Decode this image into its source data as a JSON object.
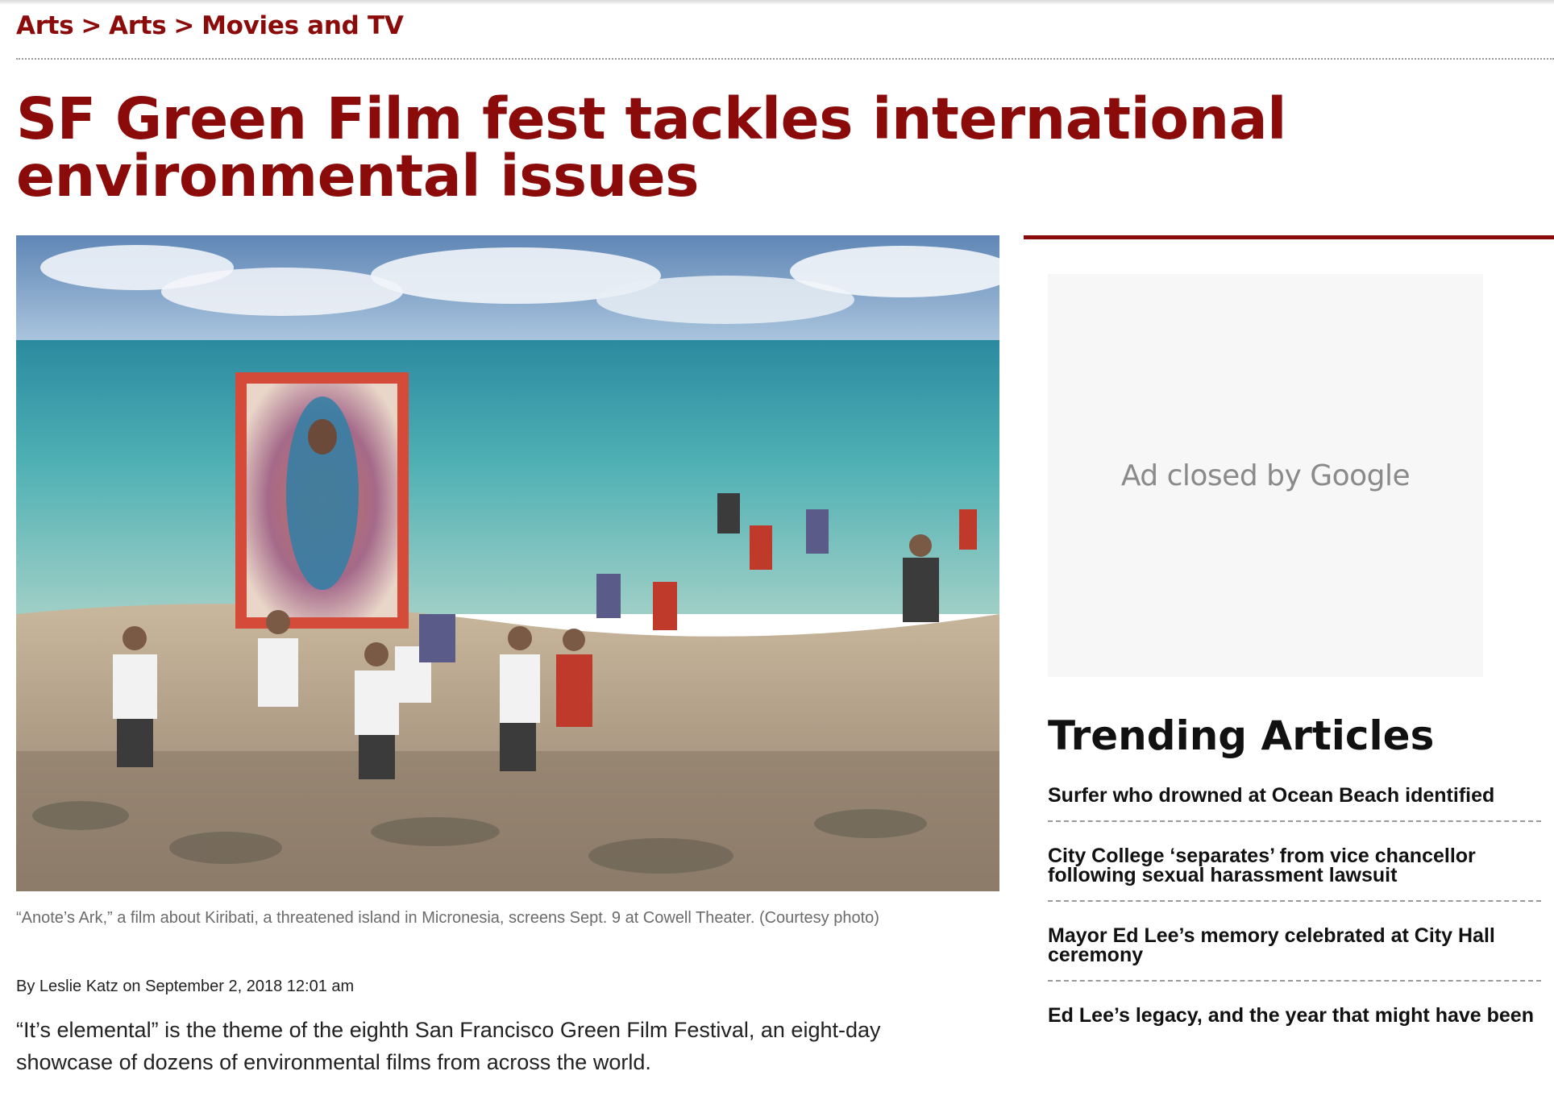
{
  "breadcrumb": {
    "items": [
      "Arts",
      "Arts",
      "Movies and TV"
    ],
    "separator": ">"
  },
  "article": {
    "title": "SF Green Film fest tackles international environmental issues",
    "image_caption": "“Anote’s Ark,” a film about Kiribati, a threatened island in Micronesia, screens Sept. 9 at Cowell Theater. (Courtesy photo)",
    "byline_prefix": "By",
    "author": "Leslie Katz",
    "date_prefix": "on",
    "date": "September 2, 2018 12:01 am",
    "lead": "“It’s elemental” is the theme of the eighth San Francisco Green Film Festival, an eight-day showcase of dozens of environmental films from across the world."
  },
  "ad": {
    "text": "Ad closed by Google"
  },
  "trending": {
    "heading": "Trending Articles",
    "items": [
      "Surfer who drowned at Ocean Beach identified",
      "City College ‘separates’ from vice chancellor following sexual harassment lawsuit",
      "Mayor Ed Lee’s memory celebrated at City Hall ceremony",
      "Ed Lee’s legacy, and the year that might have been"
    ]
  },
  "colors": {
    "brand": "#8b0b0b",
    "caption": "#6b6b6b",
    "ad_background": "#f7f7f7"
  }
}
